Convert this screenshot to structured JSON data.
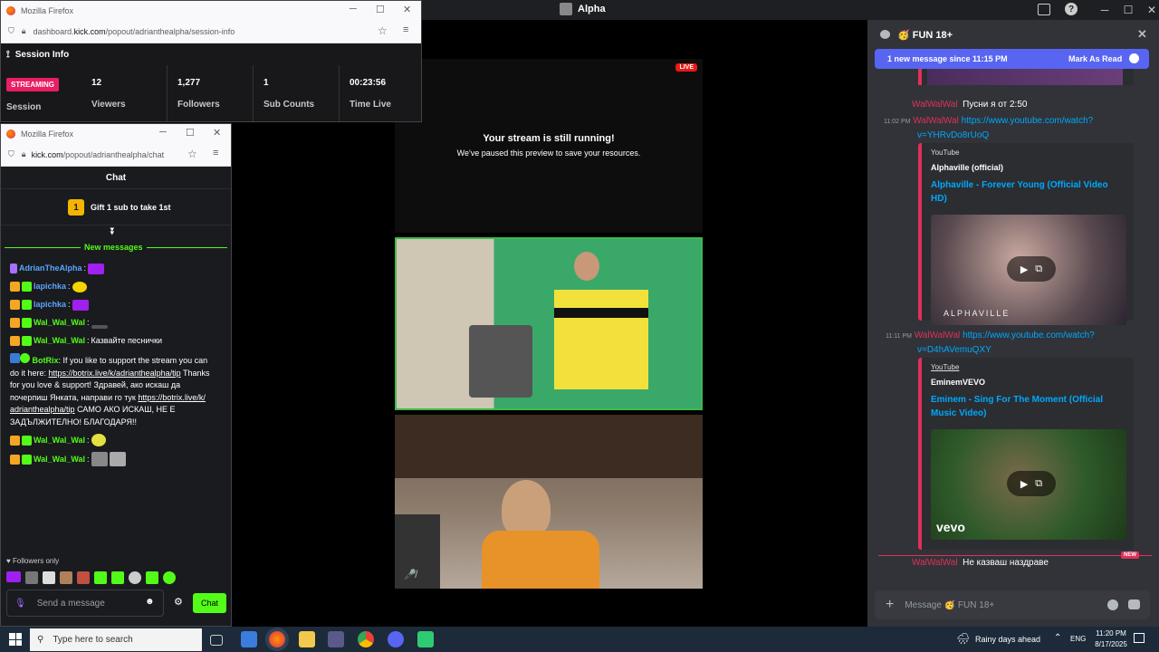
{
  "top_bar": {
    "title": "Alpha"
  },
  "session_window": {
    "app": "Mozilla Firefox",
    "url_prefix": "dashboard.",
    "url_domain": "kick.com",
    "url_path": "/popout/adrianthealpha/session-info",
    "header": "Session Info",
    "status_badge": "STREAMING",
    "session_label": "Session",
    "stats": [
      {
        "value": "12",
        "label": "Viewers"
      },
      {
        "value": "1,277",
        "label": "Followers"
      },
      {
        "value": "1",
        "label": "Sub Counts"
      },
      {
        "value": "00:23:56",
        "label": "Time Live"
      }
    ]
  },
  "chat_window": {
    "app": "Mozilla Firefox",
    "url_domain": "kick.com",
    "url_path": "/popout/adrianthealpha/chat",
    "title": "Chat",
    "gift_count": "1",
    "gift_text": "Gift 1 sub to take 1st",
    "new_messages": "New messages",
    "messages": [
      {
        "user": "AdrianTheAlpha",
        "text": ""
      },
      {
        "user": "lapichka",
        "text": ""
      },
      {
        "user": "lapichka",
        "text": ""
      },
      {
        "user": "Wal_Wal_Wal",
        "text": ""
      },
      {
        "user": "Wal_Wal_Wal",
        "text": "Казвайте песнички"
      }
    ],
    "botrix": {
      "user": "BotRix",
      "line1": "If you like to support the stream you can",
      "line2a": "do it here: ",
      "link1": "https://botrix.live/k/adrianthealpha/tip",
      "line2b": " Thanks",
      "line3": "for you love & support! Здравей, ако искаш да",
      "line4a": "почерпиш Янката, направи го тук ",
      "link2": "https://botrix.live/k/",
      "link3": "adrianthealpha/tip",
      "line5b": " САМО АКО ИСКАШ, НЕ Е",
      "line6": "ЗАДЪЛЖИТЕЛНО! БЛАГОДАРЯ!!"
    },
    "messages2": [
      {
        "user": "Wal_Wal_Wal"
      },
      {
        "user": "Wal_Wal_Wal"
      }
    ],
    "followers_only": "Followers only",
    "input_placeholder": "Send a message",
    "send_label": "Chat"
  },
  "stream": {
    "live_badge": "LIVE",
    "paused_title": "Your stream is still running!",
    "paused_sub": "We've paused this preview to save your resources."
  },
  "discord": {
    "channel": "🥳 FUN 18+",
    "new_bar": "1 new message since 11:15 PM",
    "mark_read": "Mark As Read",
    "msg1": {
      "user": "WalWalWal",
      "text": "Пусни я от 2:50"
    },
    "msg2": {
      "time": "11:02 PM",
      "user": "WalWalWal",
      "link1": "https://www.youtube.com/watch?",
      "link2": "v=YHRvDo8rUoQ"
    },
    "embed1": {
      "provider": "YouTube",
      "author": "Alphaville (official)",
      "title": "Alphaville - Forever Young (Official Video HD)",
      "watermark": "ALPHAVILLE"
    },
    "msg3": {
      "time": "11:11 PM",
      "user": "WalWalWal",
      "link1": "https://www.youtube.com/watch?",
      "link2": "v=D4hAVemuQXY"
    },
    "embed2": {
      "provider": "YouTube",
      "author": "EminemVEVO",
      "title1": "Eminem - Sing For The Moment (Official",
      "title2": "Music Video)",
      "watermark": "vevo"
    },
    "new_badge": "NEW",
    "msg4": {
      "user": "WalWalWal",
      "text": "Не казваш наздраве"
    },
    "input_placeholder": "Message 🥳 FUN 18+"
  },
  "taskbar": {
    "search_placeholder": "Type here to search",
    "weather": "Rainy days ahead",
    "lang": "ENG",
    "time": "11:20 PM",
    "date": "8/17/2025"
  }
}
